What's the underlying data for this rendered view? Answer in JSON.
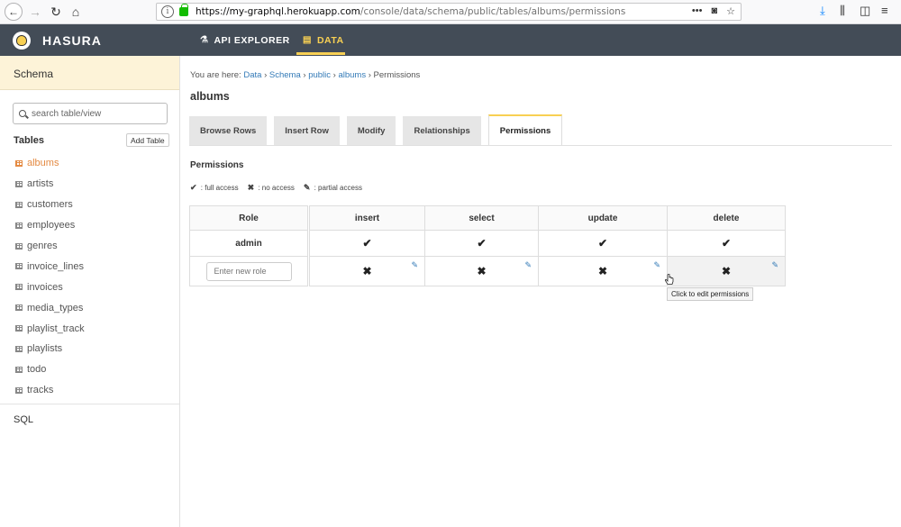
{
  "browser": {
    "url_host": "https://my-graphql.herokuapp.com",
    "url_path": "/console/data/schema/public/tables/albums/permissions",
    "more": "•••"
  },
  "app": {
    "brand": "HASURA",
    "nav": [
      {
        "label": "API EXPLORER",
        "icon": "flask-icon"
      },
      {
        "label": "DATA",
        "icon": "database-icon",
        "active": true
      }
    ],
    "accent": "#f8d053",
    "header_bg": "#434c57"
  },
  "sidebar": {
    "schema_label": "Schema",
    "search_placeholder": "search table/view",
    "tables_label": "Tables",
    "add_table": "Add Table",
    "tables": [
      "albums",
      "artists",
      "customers",
      "employees",
      "genres",
      "invoice_lines",
      "invoices",
      "media_types",
      "playlist_track",
      "playlists",
      "todo",
      "tracks"
    ],
    "active_table": "albums",
    "sql_label": "SQL"
  },
  "main": {
    "breadcrumb": {
      "prefix": "You are here:",
      "items": [
        "Data",
        "Schema",
        "public",
        "albums",
        "Permissions"
      ],
      "sep": "›"
    },
    "title": "albums",
    "tabs": [
      "Browse Rows",
      "Insert Row",
      "Modify",
      "Relationships",
      "Permissions"
    ],
    "active_tab": "Permissions",
    "permissions_title": "Permissions",
    "legend": {
      "full": "full access",
      "none": "no access",
      "partial": "partial access"
    },
    "table": {
      "columns": [
        "Role",
        "insert",
        "select",
        "update",
        "delete"
      ],
      "rows": [
        {
          "role": "admin",
          "cells": [
            "full",
            "full",
            "full",
            "full"
          ]
        }
      ],
      "new_role_placeholder": "Enter new role",
      "new_role_cells": [
        "none",
        "none",
        "none",
        "none"
      ]
    },
    "tooltip": "Click to edit permissions"
  }
}
